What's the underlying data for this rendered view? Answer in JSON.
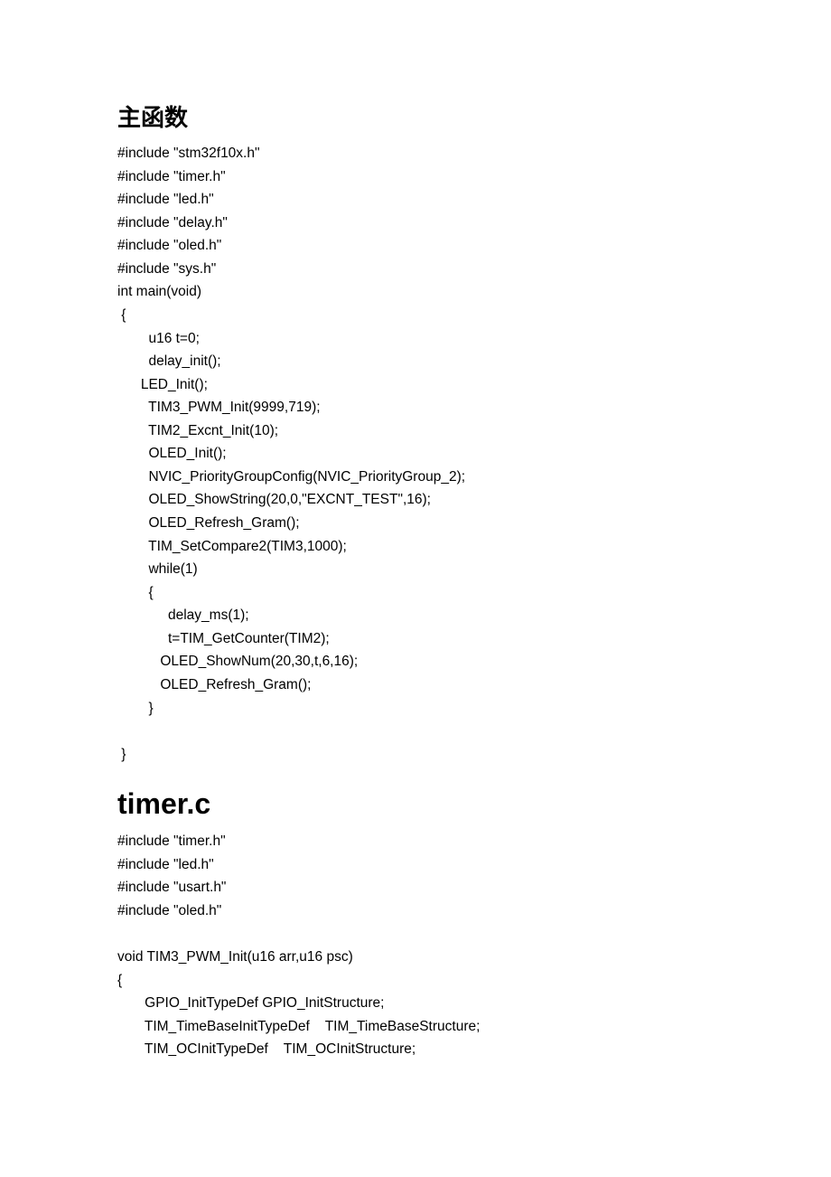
{
  "section1": {
    "title": "主函数",
    "code": "#include \"stm32f10x.h\"\n#include \"timer.h\"\n#include \"led.h\"\n#include \"delay.h\"\n#include \"oled.h\"\n#include \"sys.h\"\nint main(void)\n {\n        u16 t=0;\n        delay_init();\n      LED_Init();\n        TIM3_PWM_Init(9999,719);\n        TIM2_Excnt_Init(10);\n        OLED_Init();\n        NVIC_PriorityGroupConfig(NVIC_PriorityGroup_2);\n        OLED_ShowString(20,0,\"EXCNT_TEST\",16);\n        OLED_Refresh_Gram();\n        TIM_SetCompare2(TIM3,1000);\n        while(1)\n        {\n             delay_ms(1);\n             t=TIM_GetCounter(TIM2);\n           OLED_ShowNum(20,30,t,6,16);\n           OLED_Refresh_Gram();\n        }\n\n }"
  },
  "section2": {
    "title": "timer.c",
    "code": "#include \"timer.h\"\n#include \"led.h\"\n#include \"usart.h\"\n#include \"oled.h\"\n\nvoid TIM3_PWM_Init(u16 arr,u16 psc)\n{\n       GPIO_InitTypeDef GPIO_InitStructure;\n       TIM_TimeBaseInitTypeDef    TIM_TimeBaseStructure;\n       TIM_OCInitTypeDef    TIM_OCInitStructure;"
  }
}
